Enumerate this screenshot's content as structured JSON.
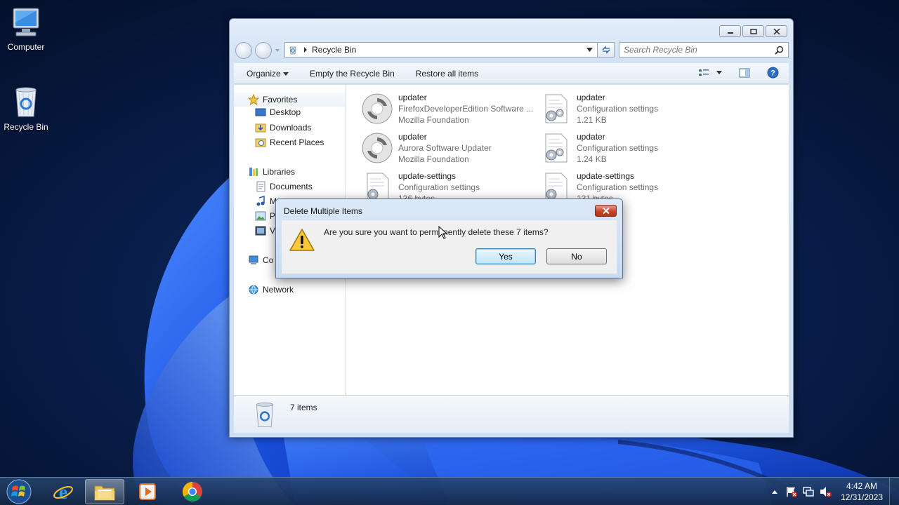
{
  "desktop": {
    "icons": [
      {
        "label": "Computer"
      },
      {
        "label": "Recycle Bin"
      }
    ]
  },
  "explorer": {
    "address": "Recycle Bin",
    "search_placeholder": "Search Recycle Bin",
    "toolbar": {
      "organize": "Organize",
      "empty": "Empty the Recycle Bin",
      "restore": "Restore all items"
    },
    "nav": {
      "favorites": "Favorites",
      "desktop": "Desktop",
      "downloads": "Downloads",
      "recent": "Recent Places",
      "libraries": "Libraries",
      "documents": "Documents",
      "music": "M",
      "pictures": "P",
      "videos": "V",
      "computer": "Co",
      "network": "Network"
    },
    "files": [
      {
        "name": "updater",
        "line2": "FirefoxDeveloperEdition Software ...",
        "line3": "Mozilla Foundation",
        "kind": "app"
      },
      {
        "name": "updater",
        "line2": "Configuration settings",
        "line3": "1.21 KB",
        "kind": "config"
      },
      {
        "name": "updater",
        "line2": "Aurora Software Updater",
        "line3": "Mozilla Foundation",
        "kind": "app"
      },
      {
        "name": "updater",
        "line2": "Configuration settings",
        "line3": "1.24 KB",
        "kind": "config"
      },
      {
        "name": "update-settings",
        "line2": "Configuration settings",
        "line3": "136 bytes",
        "kind": "config"
      },
      {
        "name": "update-settings",
        "line2": "Configuration settings",
        "line3": "131 bytes",
        "kind": "config"
      }
    ],
    "details": {
      "count": "7 items"
    }
  },
  "dialog": {
    "title": "Delete Multiple Items",
    "message": "Are you sure you want to permanently delete these 7 items?",
    "yes": "Yes",
    "no": "No"
  },
  "taskbar": {
    "time": "4:42 AM",
    "date": "12/31/2023"
  },
  "colors": {
    "wallpaper_dark": "#05163a",
    "wallpaper_bloom": "#1f5cf0",
    "window_frame": "#d3e2f5",
    "dialog_default_button": "#bee6fd",
    "close_button": "#c7432a"
  }
}
